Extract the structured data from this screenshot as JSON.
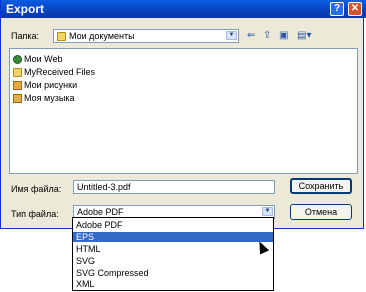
{
  "window": {
    "title": "Export",
    "help_glyph": "?",
    "close_glyph": "✕"
  },
  "lookin": {
    "label": "Папка:",
    "value": "Мои документы"
  },
  "files": [
    {
      "name": "Мои Web",
      "icon": "web-folder-icon"
    },
    {
      "name": "MyReceived Files",
      "icon": "folder-icon"
    },
    {
      "name": "Мои рисунки",
      "icon": "pictures-folder-icon"
    },
    {
      "name": "Моя музыка",
      "icon": "music-folder-icon"
    }
  ],
  "filename": {
    "label": "Имя файла:",
    "value": "Untitled-3.pdf"
  },
  "filetype": {
    "label": "Тип файла:",
    "value": "Adobe PDF",
    "options": [
      "Adobe PDF",
      "EPS",
      "HTML",
      "SVG",
      "SVG Compressed",
      "XML"
    ],
    "selected_index": 1
  },
  "buttons": {
    "save": "Сохранить",
    "cancel": "Отмена"
  },
  "colors": {
    "titlebar": "#0842c0",
    "dialog": "#ece9d8",
    "selection": "#316ac5"
  }
}
